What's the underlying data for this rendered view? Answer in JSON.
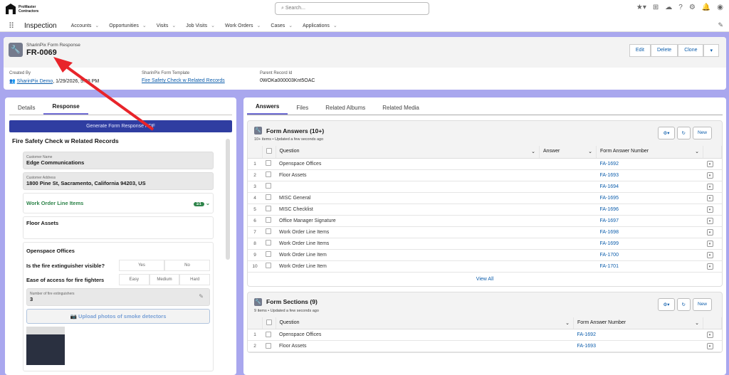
{
  "brand": {
    "line1": "ProMaster",
    "line2": "Contractors"
  },
  "search": {
    "placeholder": "Search..."
  },
  "app_name": "Inspection",
  "nav": [
    "Accounts",
    "Opportunities",
    "Visits",
    "Job Visits",
    "Work Orders",
    "Cases",
    "Applications"
  ],
  "record": {
    "type": "SharinPix Form Response",
    "name": "FR-0069",
    "actions": [
      "Edit",
      "Delete",
      "Clone"
    ],
    "fields": [
      {
        "label": "Created By",
        "value": "SharinPix Demo",
        "date": ", 1/29/2026, 5:08 PM"
      },
      {
        "label": "SharinPix Form Template",
        "value": "Fire Safety Check w Related Records"
      },
      {
        "label": "Parent Record Id",
        "value": "0WOKa000003Knt5OAC"
      }
    ]
  },
  "left": {
    "tabs": [
      "Details",
      "Response"
    ],
    "generate": "Generate Form Response PDF",
    "form_title": "Fire Safety Check w Related Records",
    "customer_name_label": "Customer Name",
    "customer_name": "Edge Communications",
    "customer_address_label": "Customer Address",
    "customer_address": "1800 Pine St, Sacramento, California 94203, US",
    "wo_line_items": "Work Order Line Items",
    "wo_badge": "1/1",
    "floor_assets": "Floor Assets",
    "openspace": "Openspace Offices",
    "q1": "Is the fire extinguisher visible?",
    "q1_opts": [
      "Yes",
      "No"
    ],
    "q2": "Ease of access for fire fighters",
    "q2_opts": [
      "Easy",
      "Medium",
      "Hard"
    ],
    "num_label": "Number of fire extinguishers",
    "num_value": "3",
    "upload": "Upload photos of smoke detectors"
  },
  "right": {
    "tabs": [
      "Answers",
      "Files",
      "Related Albums",
      "Related Media"
    ],
    "answers": {
      "title": "Form Answers (10+)",
      "subtitle": "10+ items • Updated a few seconds ago",
      "new": "New",
      "cols": [
        "Question",
        "Answer",
        "Form Answer Number"
      ],
      "rows": [
        [
          "1",
          "Openspace Offices",
          "FA-1692"
        ],
        [
          "2",
          "Floor Assets",
          "FA-1693"
        ],
        [
          "3",
          "",
          "FA-1694"
        ],
        [
          "4",
          "MISC General",
          "FA-1695"
        ],
        [
          "5",
          "MISC Checklist",
          "FA-1696"
        ],
        [
          "6",
          "Office Manager Signature",
          "FA-1697"
        ],
        [
          "7",
          "Work Order Line Items",
          "FA-1698"
        ],
        [
          "8",
          "Work Order Line Items",
          "FA-1699"
        ],
        [
          "9",
          "Work Order Line Item",
          "FA-1700"
        ],
        [
          "10",
          "Work Order Line Item",
          "FA-1701"
        ]
      ],
      "view_all": "View All"
    },
    "sections": {
      "title": "Form Sections (9)",
      "subtitle": "9 items • Updated a few seconds ago",
      "new": "New",
      "cols": [
        "Question",
        "Form Answer Number"
      ],
      "rows": [
        [
          "1",
          "Openspace Offices",
          "FA-1692"
        ],
        [
          "2",
          "Floor Assets",
          "FA-1693"
        ]
      ]
    }
  }
}
